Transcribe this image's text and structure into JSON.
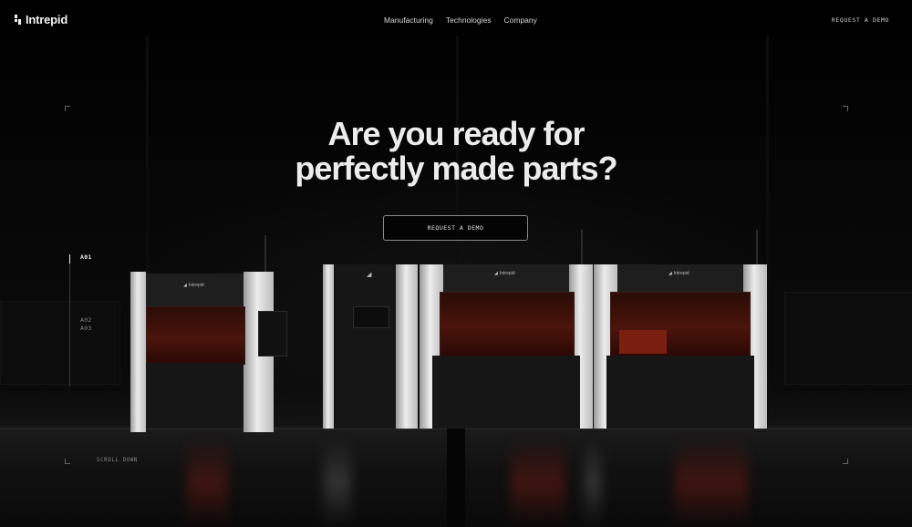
{
  "brand": {
    "name": "Intrepid"
  },
  "nav": {
    "links": [
      {
        "label": "Manufacturing"
      },
      {
        "label": "Technologies"
      },
      {
        "label": "Company"
      }
    ],
    "cta_label": "REQUEST A DEMO"
  },
  "hero": {
    "headline_line1": "Are you ready for",
    "headline_line2": "perfectly made parts?",
    "cta_label": "REQUEST A DEMO"
  },
  "indicator": {
    "items": [
      {
        "label": "A01",
        "active": true
      },
      {
        "label": "A02",
        "active": false
      },
      {
        "label": "A03",
        "active": false
      }
    ]
  },
  "scroll_hint": "SCROLL DOWN",
  "machines": {
    "brand_label": "Intrepid"
  },
  "colors": {
    "background": "#050505",
    "text": "#ececec",
    "accent_red": "#7a1e10"
  }
}
